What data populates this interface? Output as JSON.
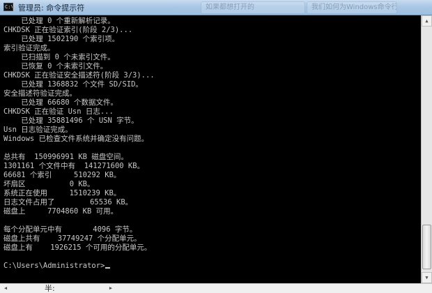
{
  "window": {
    "title": "管理员: 命令提示符",
    "icon_text": "C:\\",
    "background_tabs": [
      "如果都想打开的",
      "我们如何为Windows命令行"
    ]
  },
  "console": {
    "lines": [
      "    已处理 0 个重新解析记录。",
      "CHKDSK 正在验证索引(阶段 2/3)...",
      "    已处理 1502190 个索引项。",
      "索引验证完成。",
      "    已扫描到 0 个未索引文件。",
      "    已恢复 0 个未索引文件。",
      "CHKDSK 正在验证安全描述符(阶段 3/3)...",
      "    已处理 1368832 个文件 SD/SID。",
      "安全描述符验证完成。",
      "    已处理 66680 个数据文件。",
      "CHKDSK 正在验证 Usn 日志...",
      "    已处理 35881496 个 USN 字节。",
      "Usn 日志验证完成。",
      "Windows 已检查文件系统并确定没有问题。",
      "",
      "总共有  150996991 KB 磁盘空间。",
      "1301161 个文件中有  141271600 KB。",
      "66681 个索引     510292 KB。",
      "坏扇区          0 KB。",
      "系统正在使用     1510239 KB。",
      "日志文件占用了        65536 KB。",
      "磁盘上     7704860 KB 可用。",
      "",
      "每个分配单元中有       4096 字节。",
      "磁盘上共有    37749247 个分配单元。",
      "磁盘上有    1926215 个可用的分配单元。",
      "",
      "C:\\Users\\Administrator>"
    ]
  },
  "statusbar": {
    "text": "半:"
  }
}
